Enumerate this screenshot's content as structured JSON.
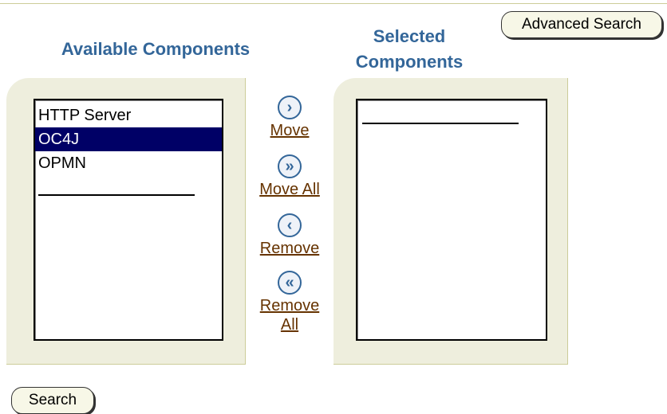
{
  "buttons": {
    "advanced_search": "Advanced Search",
    "search": "Search"
  },
  "available": {
    "heading": "Available Components",
    "items": [
      {
        "label": "HTTP Server",
        "selected": false
      },
      {
        "label": "OC4J",
        "selected": true
      },
      {
        "label": "OPMN",
        "selected": false
      }
    ]
  },
  "selected": {
    "heading_line1": "Selected",
    "heading_line2": "Components",
    "items": []
  },
  "controls": {
    "move": "Move",
    "move_all": "Move All",
    "remove": "Remove",
    "remove_all_line1": "Remove",
    "remove_all_line2": "All"
  },
  "colors": {
    "heading": "#336699",
    "link": "#663300",
    "selection": "#000066",
    "panel": "#eeeedd"
  },
  "icons": {
    "move": "chevron-right-icon",
    "move_all": "double-chevron-right-icon",
    "remove": "chevron-left-icon",
    "remove_all": "double-chevron-left-icon"
  }
}
